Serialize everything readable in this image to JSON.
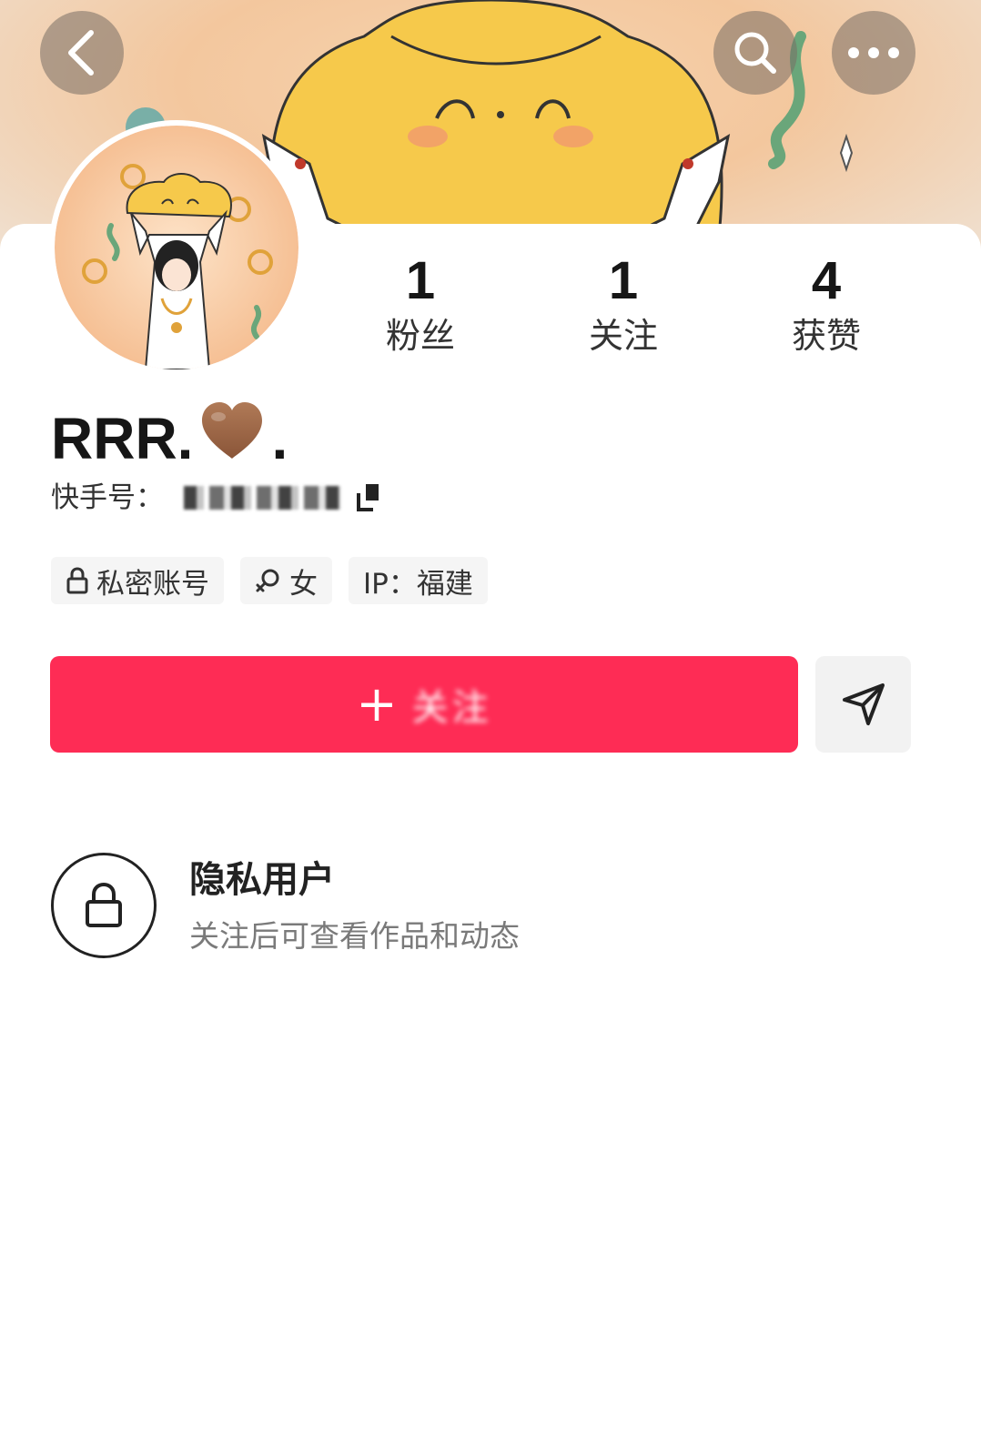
{
  "stats": {
    "fans": {
      "value": "1",
      "label": "粉丝"
    },
    "following": {
      "value": "1",
      "label": "关注"
    },
    "likes": {
      "value": "4",
      "label": "获赞"
    }
  },
  "profile": {
    "name_prefix": "RRR.",
    "name_suffix": ".",
    "account_id_label": "快手号："
  },
  "tags": {
    "private": "私密账号",
    "gender": "女",
    "ip": "IP：福建"
  },
  "actions": {
    "follow_plus": "+",
    "follow_label": "关注"
  },
  "privacy": {
    "title": "隐私用户",
    "description": "关注后可查看作品和动态"
  },
  "colors": {
    "accent": "#fe2c55",
    "heart": "#a0694a"
  }
}
